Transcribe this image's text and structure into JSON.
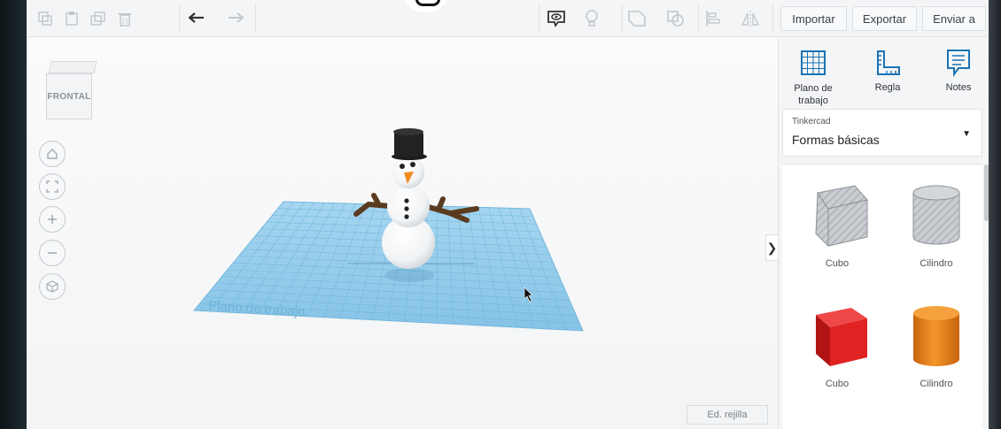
{
  "toolbar": {
    "left_icons": [
      "copy-icon",
      "paste-icon",
      "duplicate-icon",
      "trash-icon"
    ],
    "undo_icon": "undo-icon",
    "redo_icon": "redo-icon",
    "right_icons": [
      "show-hide-icon",
      "lightbulb-icon",
      "group-icon",
      "ungroup-icon",
      "align-icon",
      "mirror-icon"
    ],
    "import_label": "Importar",
    "export_label": "Exportar",
    "send_label": "Enviar a"
  },
  "viewport": {
    "viewcube_label": "FRONTAL",
    "workplane_label": "Plano de trabajo",
    "nav_icons": [
      "home-icon",
      "fit-icon",
      "zoom-in-icon",
      "zoom-out-icon",
      "ortho-icon"
    ],
    "collapse_glyph": "❯",
    "grid_button_label": "Ed. rejilla"
  },
  "panel": {
    "tools": [
      {
        "label": "Plano de trabajo",
        "icon": "workplane-icon"
      },
      {
        "label": "Regla",
        "icon": "ruler-icon"
      },
      {
        "label": "Notes",
        "icon": "notes-icon"
      }
    ],
    "library": {
      "small_label": "Tinkercad",
      "selected": "Formas básicas"
    },
    "shapes": [
      {
        "label": "Cubo",
        "color": "#b9bdc2",
        "kind": "cube-hole"
      },
      {
        "label": "Cilindro",
        "color": "#b9bdc2",
        "kind": "cylinder-hole"
      },
      {
        "label": "Cubo",
        "color": "#e02222",
        "kind": "cube"
      },
      {
        "label": "Cilindro",
        "color": "#e8821e",
        "kind": "cylinder"
      }
    ]
  },
  "colors": {
    "workplane": "#8fc9ea",
    "grid_lines": "#5faedb",
    "snowman_body": "#ffffff",
    "hat": "#1d1d1d",
    "nose": "#f08a1e",
    "arms": "#5b3b1f"
  }
}
